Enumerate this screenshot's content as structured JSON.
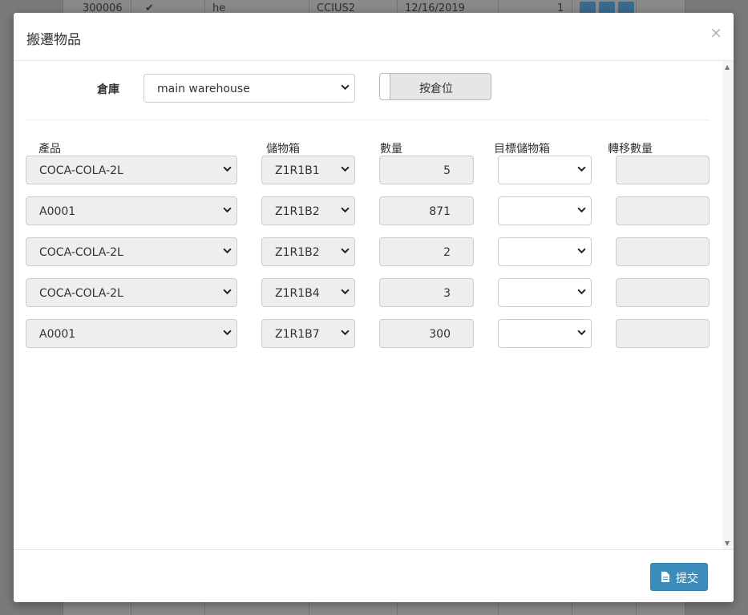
{
  "background": {
    "top_row": [
      "300006",
      "he",
      "CCIUS2",
      "12/16/2019",
      "1"
    ],
    "bottom_row": [
      "",
      ""
    ]
  },
  "modal": {
    "title": "搬遷物品",
    "close_symbol": "×",
    "warehouse_label": "倉庫",
    "warehouse_value": "main warehouse",
    "toggle_label": "按倉位",
    "columns": [
      "產品",
      "儲物箱",
      "數量",
      "目標儲物箱",
      "轉移數量"
    ],
    "rows": [
      {
        "product": "COCA-COLA-2L",
        "bin": "Z1R1B1",
        "qty": "5"
      },
      {
        "product": "A0001",
        "bin": "Z1R1B2",
        "qty": "871"
      },
      {
        "product": "COCA-COLA-2L",
        "bin": "Z1R1B2",
        "qty": "2"
      },
      {
        "product": "COCA-COLA-2L",
        "bin": "Z1R1B4",
        "qty": "3"
      },
      {
        "product": "A0001",
        "bin": "Z1R1B7",
        "qty": "300"
      }
    ],
    "submit_label": "提交"
  },
  "colors": {
    "primary": "#3c8dbc",
    "overlay": "#7a7a7a"
  },
  "icons": {
    "close": "close-icon",
    "submit": "document-icon",
    "check": "check-icon"
  }
}
